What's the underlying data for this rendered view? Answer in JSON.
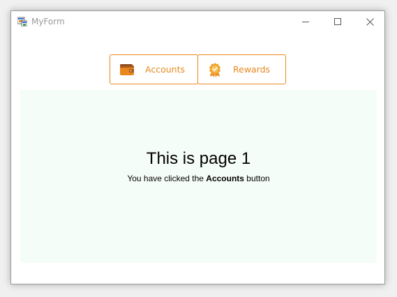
{
  "window": {
    "title": "MyForm",
    "controls": {
      "minimize": "minimize-icon",
      "maximize": "maximize-icon",
      "close": "close-icon"
    }
  },
  "nav": {
    "accent_color": "#e8871e",
    "buttons": [
      {
        "label": "Accounts",
        "icon": "wallet-icon",
        "selected": true
      },
      {
        "label": "Rewards",
        "icon": "award-badge-icon",
        "selected": false
      }
    ]
  },
  "page": {
    "background_color": "#f5fdf8",
    "heading": "This is page 1",
    "message_prefix": "You have clicked the ",
    "message_emphasis": "Accounts",
    "message_suffix": " button"
  }
}
